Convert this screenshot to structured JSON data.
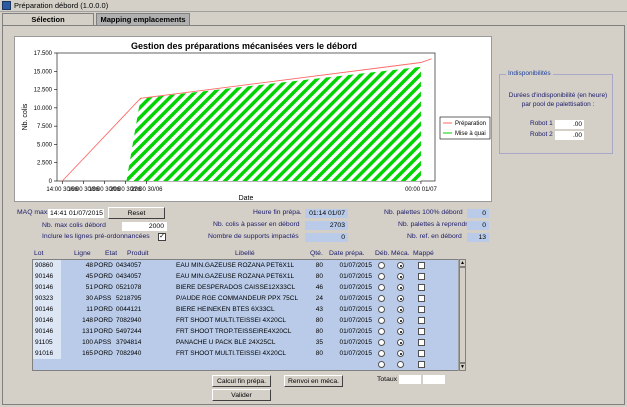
{
  "window": {
    "title": "Préparation débord (1.0.0.0)"
  },
  "tabs": [
    {
      "label": "Sélection"
    },
    {
      "label": "Mapping emplacements"
    }
  ],
  "chart_data": {
    "type": "area",
    "title": "Gestion des préparations mécanisées vers le débord",
    "xlabel": "Date",
    "ylabel": "Nb. colis",
    "x_ticks": [
      "14:00 30/06",
      "16:00 30/06",
      "18:00 30/06",
      "20:00 30/06",
      "22:00 30/06",
      "00:00 01/07"
    ],
    "x_range": [
      "13:30 30/06",
      "01:20 01/07"
    ],
    "ylim": [
      0,
      17500
    ],
    "y_ticks": [
      0,
      2500,
      5000,
      7500,
      10000,
      12500,
      15000,
      17500
    ],
    "grid": false,
    "legend_position": "right",
    "series": [
      {
        "name": "Préparation",
        "color": "#ff6a6a",
        "points": [
          [
            "14:00 30/06",
            0
          ],
          [
            "21:25 30/06",
            11300
          ],
          [
            "00:00 01/07",
            16200
          ],
          [
            "01:00 01/07",
            16700
          ]
        ]
      },
      {
        "name": "Mise à quai",
        "color": "#00cc00",
        "points": [
          [
            "20:05 30/06",
            0
          ],
          [
            "21:25 30/06",
            11300
          ],
          [
            "00:00 01/07",
            15600
          ]
        ]
      }
    ]
  },
  "dispo": {
    "legend": "Indisponibilités",
    "desc": "Durées d'indisponibilité (en heure) par pool de palettisation :",
    "robots": [
      {
        "label": "Robot 1",
        "value": ".00"
      },
      {
        "label": "Robot 2",
        "value": ".00"
      }
    ]
  },
  "params": {
    "maq_label": "MAQ max.",
    "maq_value": "14:41 01/07/2015",
    "reset_label": "Reset",
    "nbmax_label": "Nb. max colis débord",
    "nbmax_value": "2000",
    "inclure_label": "Inclure les lignes pré-ordonnancées",
    "heure_fin_label": "Heure fin prépa.",
    "heure_fin_value": "01:14 01/07",
    "nb_colis_label": "Nb. colis à passer en débord",
    "nb_colis_value": "2703",
    "nb_supports_label": "Nombre de supports impactés",
    "nb_supports_value": "0",
    "nb_pal100_label": "Nb. palettes 100% débord",
    "nb_pal100_value": "0",
    "nb_palrep_label": "Nb. palettes à reprendre",
    "nb_palrep_value": "0",
    "nb_ref_label": "Nb. ref. en débord",
    "nb_ref_value": "13"
  },
  "table": {
    "headers": [
      "Lot",
      "Ligne",
      "Etat",
      "Produit",
      "Libellé",
      "Qté.",
      "Date prépa.",
      "Déb.",
      "Méca.",
      "Mappé"
    ],
    "rows": [
      [
        "90860",
        "48",
        "PORD",
        "0434057",
        "EAU MIN.GAZEUSE ROZANA PET6X1L",
        "80",
        "01/07/2015"
      ],
      [
        "90146",
        "45",
        "PORD",
        "0434057",
        "EAU MIN.GAZEUSE ROZANA PET6X1L",
        "80",
        "01/07/2015"
      ],
      [
        "90146",
        "51",
        "PORD",
        "0521078",
        "BIERE DESPERADOS CAISSE12X33CL",
        "46",
        "01/07/2015"
      ],
      [
        "90323",
        "30",
        "APSS",
        "5218795",
        "P/AUDE RGE COMMANDEUR PPX 75CL",
        "24",
        "01/07/2015"
      ],
      [
        "90146",
        "11",
        "PORD",
        "0044121",
        "BIERE HEINEKEN BTES 6X33CL",
        "43",
        "01/07/2015"
      ],
      [
        "90146",
        "148",
        "PORD",
        "7082940",
        "FRT SHOOT MULTI.TEISSEI 4X20CL",
        "80",
        "01/07/2015"
      ],
      [
        "90146",
        "131",
        "PORD",
        "5497244",
        "FRT SHOOT TROP.TEISSEIRE4X20CL",
        "80",
        "01/07/2015"
      ],
      [
        "91105",
        "100",
        "APSS",
        "3794814",
        "PANACHE U PACK BLE 24X25CL",
        "35",
        "01/07/2015"
      ],
      [
        "91016",
        "165",
        "PORD",
        "7082940",
        "FRT SHOOT MULTI.TEISSEI 4X20CL",
        "80",
        "01/07/2015"
      ]
    ]
  },
  "buttons": {
    "calcul": "Calcul fin prépa.",
    "renvoi": "Renvoi en méca.",
    "valider": "Valider",
    "totaux": "Totaux"
  }
}
